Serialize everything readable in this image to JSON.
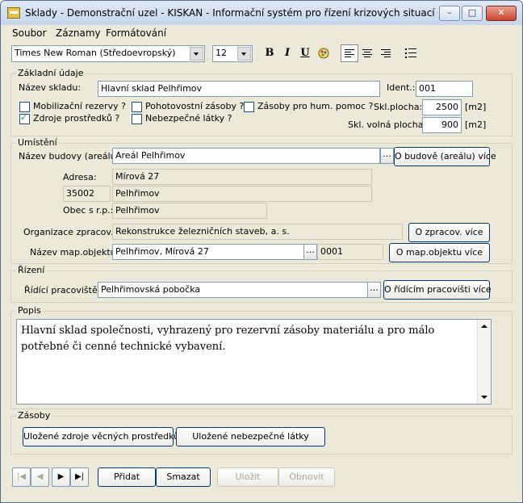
{
  "window": {
    "title": "Sklady - Demonstrační uzel - KISKAN - Informační systém pro řízení krizových situací",
    "minimize_glyph": "–",
    "maximize_glyph": "□",
    "close_glyph": "✕"
  },
  "menu": [
    "Soubor",
    "Záznamy",
    "Formátování"
  ],
  "toolbar": {
    "font": "Times New Roman (Středoevropský)",
    "size": "12",
    "bold": "B",
    "italic": "I",
    "underline": "U",
    "icons": [
      "format-brush-icon",
      "align-left-icon",
      "align-center-icon",
      "align-right-icon",
      "bullet-list-icon"
    ]
  },
  "zakladni": {
    "legend": "Základní údaje",
    "nazev_label": "Název skladu:",
    "nazev_value": "Hlavní sklad Pelhřimov",
    "ident_label": "Ident.:",
    "ident_value": "001",
    "checkboxes": [
      {
        "label": "Mobilizační rezervy ?",
        "checked": false
      },
      {
        "label": "Pohotovostní zásoby ?",
        "checked": false
      },
      {
        "label": "Zásoby pro hum. pomoc ?",
        "checked": false
      },
      {
        "label": "Zdroje prostředků ?",
        "checked": true
      },
      {
        "label": "Nebezpečné látky ?",
        "checked": false
      }
    ],
    "plocha_label": "Skl.plocha:",
    "plocha_value": "2500",
    "plocha_unit": "[m2]",
    "volna_label": "Skl. volná plocha:",
    "volna_value": "900",
    "volna_unit": "[m2]"
  },
  "umisteni": {
    "legend": "Umístění",
    "budova_label": "Název budovy (areálu)",
    "budova_value": "Areál Pelhřimov",
    "budova_button": "O budově (areálu) více",
    "adresa_label": "Adresa:",
    "adresa_value": "Mírová 27",
    "psc_value": "35002",
    "obec_value": "Pelhřimov",
    "obec_rp_label": "Obec s r.p.:",
    "obec_rp_value": "Pelhřimov",
    "org_label": "Organizace zpracov.:",
    "org_value": "Rekonstrukce železničních staveb, a. s.",
    "org_button": "O zpracov. více",
    "map_label": "Název map.objektu:",
    "map_value": "Pelhřimov, Mírová 27",
    "map_code": "0001",
    "map_button": "O map.objektu více"
  },
  "rizeni": {
    "legend": "Řízení",
    "label": "Řídící pracoviště:",
    "value": "Pelhřimovská pobočka",
    "button": "O řídícím pracovišti více"
  },
  "popis": {
    "legend": "Popis",
    "text": "Hlavní sklad společnosti, vyhrazený pro rezervní zásoby materiálu a pro málo potřebné či cenné technické vybavení."
  },
  "zasoby": {
    "legend": "Zásoby",
    "button1": "Uložené zdroje věcných prostředků",
    "button2": "Uložené nebezpečné látky"
  },
  "ellipsis": "...",
  "nav": {
    "first": "|◀",
    "prev": "◀",
    "next": "▶",
    "last": "▶|",
    "pridat": "Přidat",
    "smazat": "Smazat",
    "ulozit": "Uložit",
    "obnovit": "Obnovit"
  }
}
